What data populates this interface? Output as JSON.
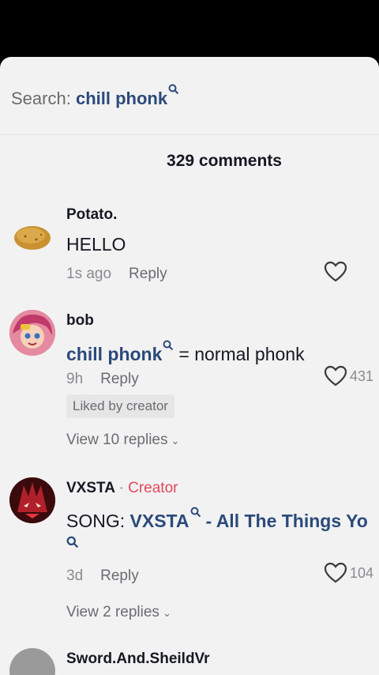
{
  "search": {
    "prefix": "Search:",
    "term": "chill phonk"
  },
  "comment_count": "329 comments",
  "comments": [
    {
      "user": "Potato.",
      "text": "HELLO",
      "time": "1s ago",
      "reply": "Reply",
      "likes": ""
    },
    {
      "user": "bob",
      "link": "chill phonk",
      "text_rest": "= normal phonk",
      "time": "9h",
      "reply": "Reply",
      "likes": "431",
      "liked_by": "Liked by creator",
      "view_replies": "View 10 replies"
    },
    {
      "user": "VXSTA",
      "creator_dot": "·",
      "creator": "Creator",
      "song_prefix": "SONG:",
      "song_artist": "VXSTA",
      "song_rest": "- All The Things Yo",
      "time": "3d",
      "reply": "Reply",
      "likes": "104",
      "view_replies": "View 2 replies"
    },
    {
      "user": "Sword.And.SheildVr"
    }
  ],
  "icons": {
    "search": "search-icon",
    "heart": "heart-outline-icon",
    "chevron": "chevron-down-icon"
  },
  "colors": {
    "link": "#2b4a7a",
    "creator": "#e0485d",
    "sheet": "#f2f2f2"
  }
}
